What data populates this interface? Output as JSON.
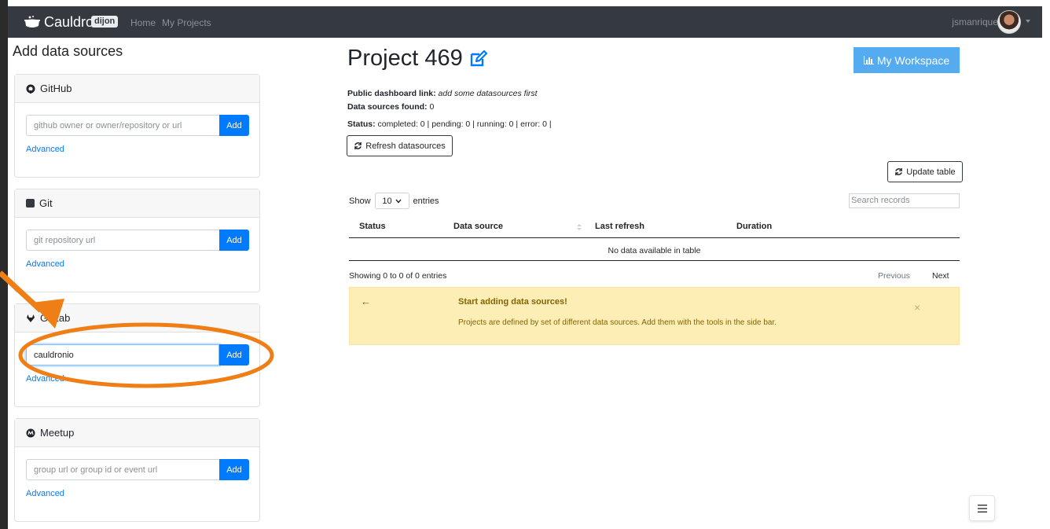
{
  "navbar": {
    "brand": "Cauldron",
    "badge": "dijon",
    "links": [
      "Home",
      "My Projects"
    ],
    "user": "jsmanrique"
  },
  "sidebar": {
    "title": "Add data sources",
    "cards": [
      {
        "name": "GitHub",
        "placeholder": "github owner or owner/repository or url",
        "value": "",
        "add": "Add",
        "advanced": "Advanced"
      },
      {
        "name": "Git",
        "placeholder": "git repository url",
        "value": "",
        "add": "Add",
        "advanced": "Advanced"
      },
      {
        "name": "GitLab",
        "placeholder": "",
        "value": "cauldronio",
        "add": "Add",
        "advanced": "Advanced"
      },
      {
        "name": "Meetup",
        "placeholder": "group url or group id or event url",
        "value": "",
        "add": "Add",
        "advanced": "Advanced"
      }
    ]
  },
  "main": {
    "title": "Project 469",
    "workspace_button": "My Workspace",
    "public_label": "Public dashboard link:",
    "public_value": "add some datasources first",
    "found_label": "Data sources found:",
    "found_value": "0",
    "status_label": "Status:",
    "status_value": "completed: 0 | pending: 0 | running: 0 | error: 0 |",
    "refresh_button": "Refresh datasources",
    "update_button": "Update table",
    "show_label": "Show",
    "show_value": "10",
    "entries_label": "entries",
    "search_placeholder": "Search records",
    "columns": [
      "Status",
      "Data source",
      "Last refresh",
      "Duration"
    ],
    "empty_text": "No data available in table",
    "showing_text": "Showing 0 to 0 of 0 entries",
    "prev": "Previous",
    "next": "Next",
    "alert_title": "Start adding data sources!",
    "alert_text": "Projects are defined by set of different data sources. Add them with the tools in the side bar.",
    "alert_close": "×"
  },
  "colors": {
    "navbar": "#343a40",
    "primary": "#007bff",
    "workspace": "#55abf0",
    "alert_bg": "#fdeeb5",
    "annotation": "#f07e16"
  }
}
